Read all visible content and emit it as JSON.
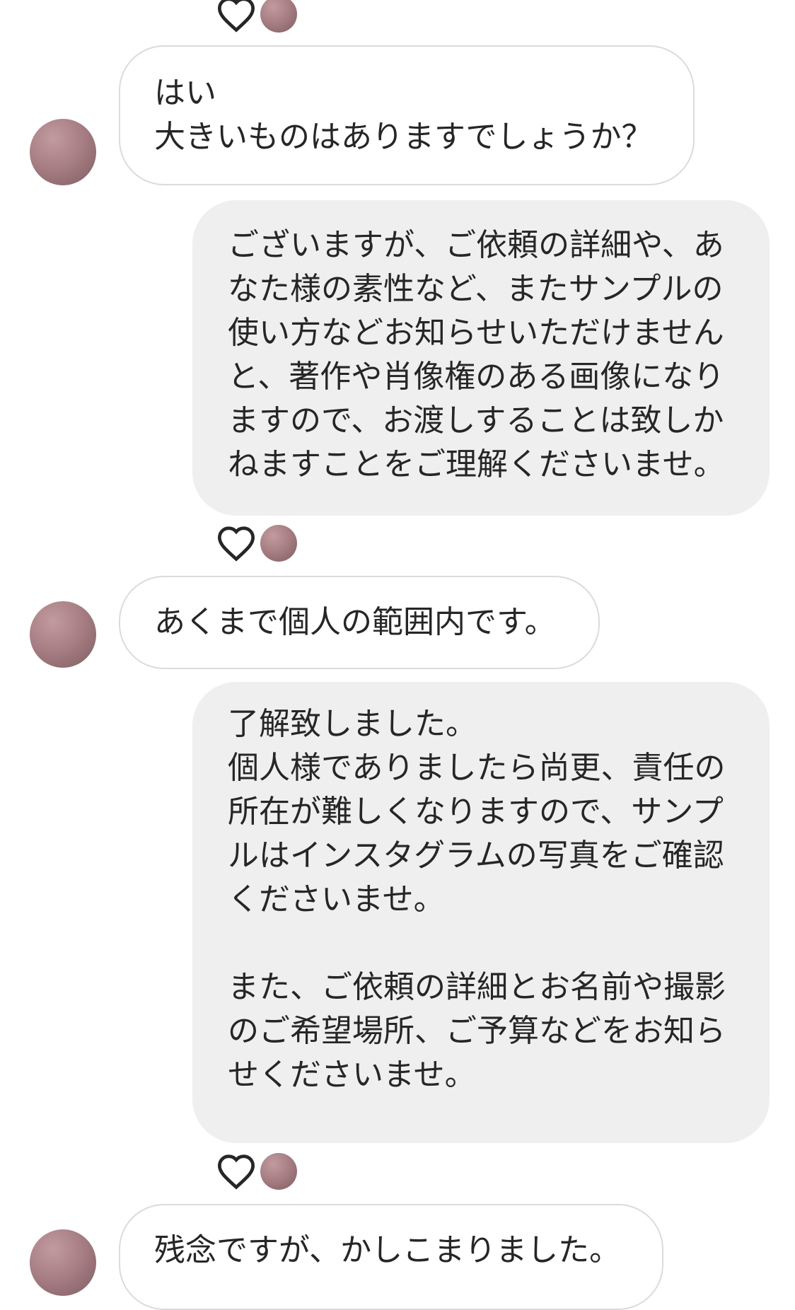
{
  "conversation": {
    "messages": [
      {
        "sender": "other",
        "lines": [
          "はい",
          "大きいものはありますでしょうか？"
        ]
      },
      {
        "sender": "me",
        "lines": [
          "ございますが、ご依頼の詳細や、あ",
          "なた様の素性など、またサンプルの",
          "使い方などお知らせいただけません",
          "と、著作や肖像権のある画像になり",
          "ますので、お渡しすることは致しか",
          "ねますことをご理解くださいませ。"
        ]
      },
      {
        "sender": "other",
        "lines": [
          "あくまで個人の範囲内です。"
        ]
      },
      {
        "sender": "me",
        "lines": [
          "了解致しました。",
          "個人様でありましたら尚更、責任の",
          "所在が難しくなりますので、サンプ",
          "ルはインスタグラムの写真をご確認",
          "くださいませ。",
          "",
          "また、ご依頼の詳細とお名前や撮影",
          "のご希望場所、ご予算などをお知ら",
          "せくださいませ。"
        ]
      },
      {
        "sender": "other",
        "lines": [
          "残念ですが、かしこまりました。"
        ]
      }
    ],
    "icons": {
      "like": "heart-outline-icon",
      "seen": "avatar"
    },
    "colors": {
      "incoming_bubble": "#ffffff",
      "incoming_border": "#dbdbdb",
      "outgoing_bubble": "#efefef",
      "text": "#262626",
      "avatar": "#a87f84"
    }
  }
}
